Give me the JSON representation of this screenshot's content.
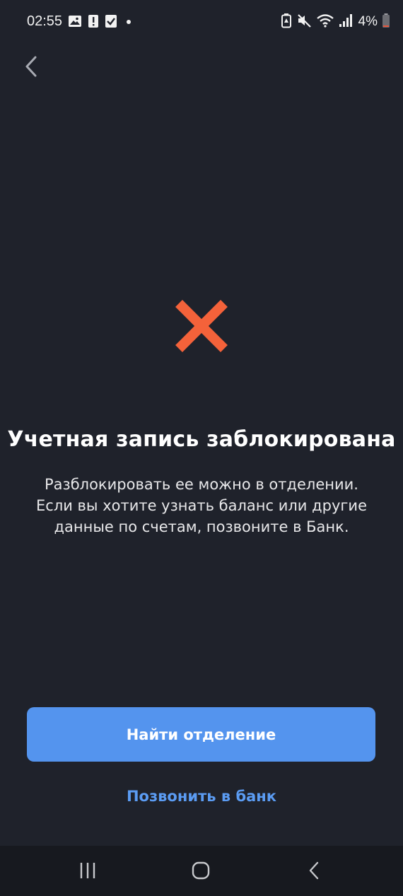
{
  "status_bar": {
    "time": "02:55",
    "battery_percent": "4%",
    "left_icons": [
      "image-icon",
      "alert-icon",
      "check-box-icon",
      "dot-icon"
    ],
    "right_icons": [
      "battery-saver-icon",
      "mute-icon",
      "wifi-icon",
      "signal-icon",
      "battery-icon"
    ]
  },
  "header": {
    "back_icon": "chevron-left-icon"
  },
  "message": {
    "icon": "close-icon",
    "icon_color": "#f4623a",
    "title": "Учетная запись заблокирована",
    "description_lines": [
      "Разблокировать ее можно в отделении.",
      "Если вы хотите узнать баланс или другие",
      "данные по счетам, позвоните в Банк."
    ]
  },
  "actions": {
    "primary_label": "Найти отделение",
    "secondary_label": "Позвонить в банк",
    "primary_color": "#5494ee",
    "link_color": "#5b9cf3"
  },
  "nav_bar": {
    "icons": [
      "recents-icon",
      "home-icon",
      "back-icon"
    ]
  }
}
